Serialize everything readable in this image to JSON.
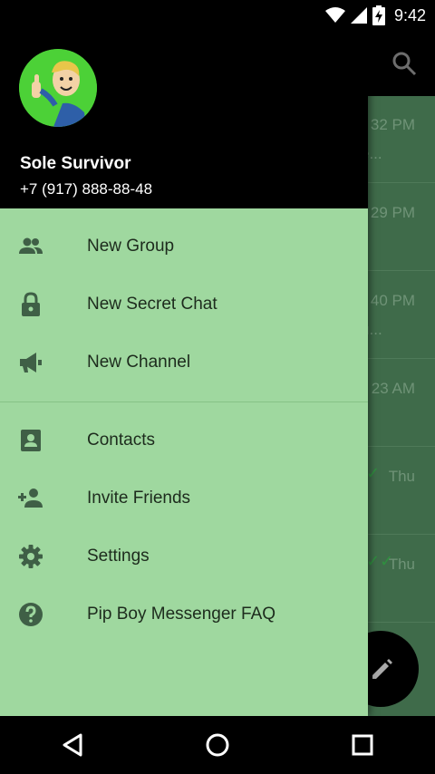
{
  "status_bar": {
    "time": "9:42"
  },
  "user": {
    "name": "Sole Survivor",
    "phone": "+7 (917) 888-88-48"
  },
  "menu": {
    "section1": [
      {
        "label": "New Group",
        "icon": "group-icon"
      },
      {
        "label": "New Secret Chat",
        "icon": "lock-icon"
      },
      {
        "label": "New Channel",
        "icon": "megaphone-icon"
      }
    ],
    "section2": [
      {
        "label": "Contacts",
        "icon": "contact-card-icon"
      },
      {
        "label": "Invite Friends",
        "icon": "add-person-icon"
      },
      {
        "label": "Settings",
        "icon": "gear-icon"
      },
      {
        "label": "Pip Boy Messenger FAQ",
        "icon": "help-icon"
      }
    ]
  },
  "background_chats": [
    {
      "time": "32 PM",
      "preview": "e..."
    },
    {
      "time": "29 PM",
      "preview": ""
    },
    {
      "time": "40 PM",
      "preview": "й..."
    },
    {
      "time": "23 AM",
      "preview": ""
    },
    {
      "time": "Thu",
      "preview": ""
    },
    {
      "time": "Thu",
      "preview": ""
    }
  ],
  "colors": {
    "drawer_bg": "#9fd89f",
    "header_bg": "#000000",
    "icon": "#3f5f46"
  }
}
